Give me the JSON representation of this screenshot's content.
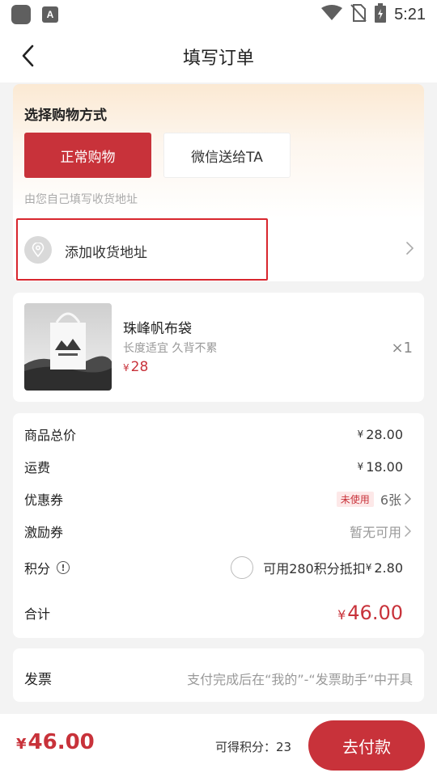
{
  "status_bar": {
    "time": "5:21",
    "app_icon_letter": "A",
    "icons": [
      "app-icon",
      "text-app-icon",
      "wifi-icon",
      "no-sim-icon",
      "battery-icon"
    ]
  },
  "header": {
    "title": "填写订单",
    "back_icon": "chevron-left-icon"
  },
  "shopping_mode": {
    "title": "选择购物方式",
    "options": [
      {
        "label": "正常购物",
        "selected": true
      },
      {
        "label": "微信送给TA",
        "selected": false
      }
    ],
    "hint": "由您自己填写收货地址"
  },
  "address": {
    "label": "添加收货地址",
    "icon": "location-pin-icon"
  },
  "product": {
    "name": "珠峰帆布袋",
    "desc": "长度适宜 久背不累",
    "price_symbol": "¥",
    "price": "28",
    "quantity": "×1"
  },
  "summary": {
    "subtotal_label": "商品总价",
    "subtotal_symbol": "¥",
    "subtotal_value": "28.00",
    "shipping_label": "运费",
    "shipping_symbol": "¥",
    "shipping_value": "18.00",
    "coupon_label": "优惠券",
    "coupon_badge": "未使用",
    "coupon_value": "6张",
    "incentive_label": "激励券",
    "incentive_value": "暂无可用",
    "points_label": "积分",
    "points_info_glyph": "!",
    "points_value_text": "可用280积分抵扣",
    "points_symbol": "¥",
    "points_value": "2.80",
    "total_label": "合计",
    "total_symbol": "¥",
    "total_value": "46.00"
  },
  "invoice": {
    "label": "发票",
    "value": "支付完成后在“我的”-“发票助手”中开具"
  },
  "bottom_bar": {
    "price_symbol": "¥",
    "price": "46.00",
    "points_text": "可得积分：23",
    "pay_label": "去付款"
  },
  "colors": {
    "accent": "#c8323a",
    "highlight_border": "#d8262e",
    "background": "#f3f3f3"
  }
}
